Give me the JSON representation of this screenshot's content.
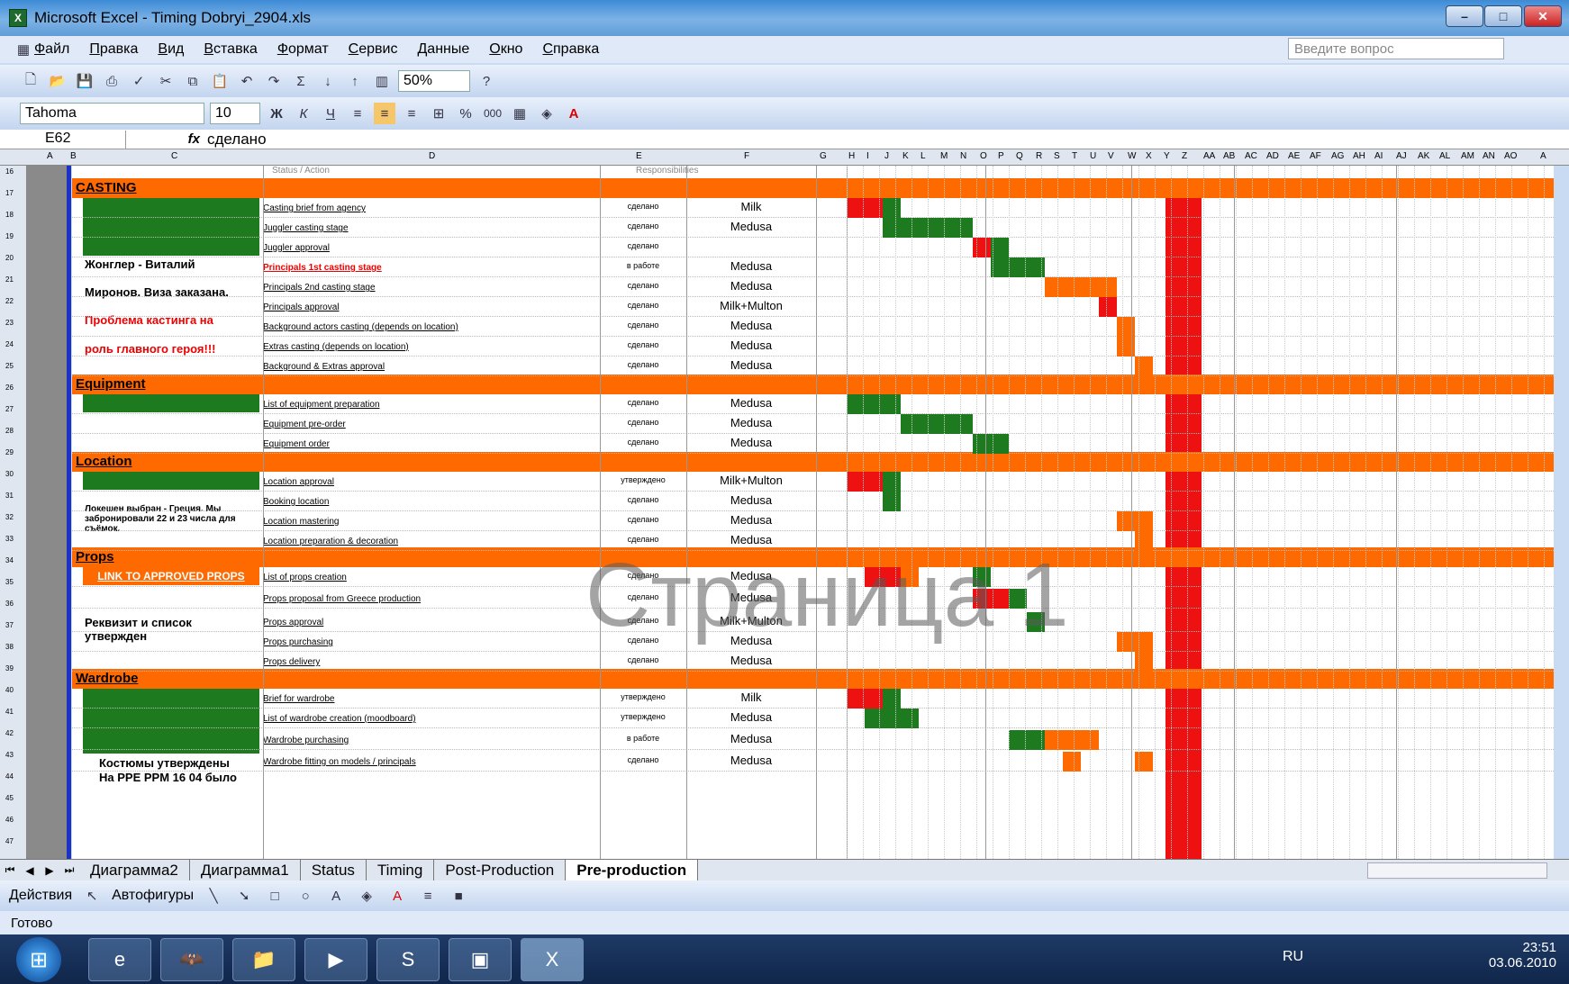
{
  "window": {
    "title": "Microsoft Excel - Timing Dobryi_2904.xls"
  },
  "menu": [
    "Файл",
    "Правка",
    "Вид",
    "Вставка",
    "Формат",
    "Сервис",
    "Данные",
    "Окно",
    "Справка"
  ],
  "help_placeholder": "Введите вопрос",
  "toolbar": {
    "zoom": "50%",
    "font": "Tahoma",
    "size": "10",
    "bold": "Ж",
    "italic": "К",
    "underline": "Ч",
    "percent": "%",
    "thousands": "000"
  },
  "formula": {
    "cell": "E62",
    "fx": "fx",
    "value": "сделано"
  },
  "columns": [
    "A",
    "B",
    "C",
    "D",
    "E",
    "F",
    "G",
    "H",
    "I",
    "J",
    "K",
    "L",
    "M",
    "N",
    "O",
    "P",
    "Q",
    "R",
    "S",
    "T",
    "U",
    "V",
    "W",
    "X",
    "Y",
    "Z",
    "AA",
    "AB",
    "AC",
    "AD",
    "AE",
    "AF",
    "AG",
    "AH",
    "AI",
    "AJ",
    "AK",
    "AL",
    "AM",
    "AN",
    "AO",
    "A"
  ],
  "rows": [
    "16",
    "17",
    "18",
    "19",
    "20",
    "21",
    "22",
    "23",
    "24",
    "25",
    "26",
    "27",
    "28",
    "29",
    "30",
    "31",
    "32",
    "33",
    "34",
    "35",
    "36",
    "37",
    "38",
    "39",
    "40",
    "41",
    "42",
    "43",
    "44",
    "45",
    "46",
    "47"
  ],
  "header_labels": {
    "status": "Status / Action",
    "resp": "Responsibilities"
  },
  "sections": {
    "casting": "CASTING",
    "equipment": "Equipment",
    "location": "Location",
    "props": "Props",
    "wardrobe": "Wardrobe"
  },
  "notes": {
    "casting1": "Жонглер - Виталий",
    "casting2": "Миронов. Виза заказана.",
    "casting3": "Проблема кастинга на",
    "casting4": "роль главного героя!!!",
    "location": "Локешен выбран - Греция. Мы забронировали 22 и 23 числа для съёмок.",
    "props_link": "LINK TO APPROVED PROPS",
    "props": "Реквизит и список утвержден",
    "wardrobe1": "Костюмы утверждены",
    "wardrobe2": "На PPE PPM 16 04 было"
  },
  "tasks": [
    {
      "t": "Casting brief from agency",
      "s": "сделано",
      "r": "Milk"
    },
    {
      "t": "Juggler casting stage",
      "s": "сделано",
      "r": "Medusa"
    },
    {
      "t": "Juggler approval",
      "s": "сделано",
      "r": ""
    },
    {
      "t": "Principals 1st casting stage",
      "s": "в работе",
      "r": "Medusa"
    },
    {
      "t": "Principals 2nd casting stage",
      "s": "сделано",
      "r": "Medusa"
    },
    {
      "t": "Principals approval",
      "s": "сделано",
      "r": "Milk+Multon"
    },
    {
      "t": "Background actors casting (depends on location)",
      "s": "сделано",
      "r": "Medusa"
    },
    {
      "t": "Extras casting (depends on location)",
      "s": "сделано",
      "r": "Medusa"
    },
    {
      "t": "Background & Extras approval",
      "s": "сделано",
      "r": "Medusa"
    },
    {
      "t": "List of equipment preparation",
      "s": "сделано",
      "r": "Medusa"
    },
    {
      "t": "Equipment pre-order",
      "s": "сделано",
      "r": "Medusa"
    },
    {
      "t": "Equipment order",
      "s": "сделано",
      "r": "Medusa"
    },
    {
      "t": "Location approval",
      "s": "утверждено",
      "r": "Milk+Multon"
    },
    {
      "t": "Booking location",
      "s": "сделано",
      "r": "Medusa"
    },
    {
      "t": "Location mastering",
      "s": "сделано",
      "r": "Medusa"
    },
    {
      "t": "Location preparation & decoration",
      "s": "сделано",
      "r": "Medusa"
    },
    {
      "t": "List of props creation",
      "s": "сделано",
      "r": "Medusa"
    },
    {
      "t": "Props proposal from Greece production",
      "s": "сделано",
      "r": "Medusa"
    },
    {
      "t": "Props approval",
      "s": "сделано",
      "r": "Milk+Multon"
    },
    {
      "t": "Props purchasing",
      "s": "сделано",
      "r": "Medusa"
    },
    {
      "t": "Props delivery",
      "s": "сделано",
      "r": "Medusa"
    },
    {
      "t": "Brief for wardrobe",
      "s": "утверждено",
      "r": "Milk"
    },
    {
      "t": "List of wardrobe creation (moodboard)",
      "s": "утверждено",
      "r": "Medusa"
    },
    {
      "t": "Wardrobe purchasing",
      "s": "в работе",
      "r": "Medusa"
    },
    {
      "t": "Wardrobe fitting on models / principals",
      "s": "сделано",
      "r": "Medusa"
    }
  ],
  "watermark": "Страница 1",
  "sheet_tabs": [
    "Диаграмма2",
    "Диаграмма1",
    "Status",
    "Timing",
    "Post-Production",
    "Pre-production"
  ],
  "drawing": {
    "actions": "Действия",
    "autoshapes": "Автофигуры"
  },
  "status_text": "Готово",
  "taskbar": {
    "lang": "RU",
    "time": "23:51",
    "date": "03.06.2010"
  },
  "colors": {
    "orange": "#ff6a00",
    "green": "#1e7a1e",
    "red": "#ee1111"
  }
}
